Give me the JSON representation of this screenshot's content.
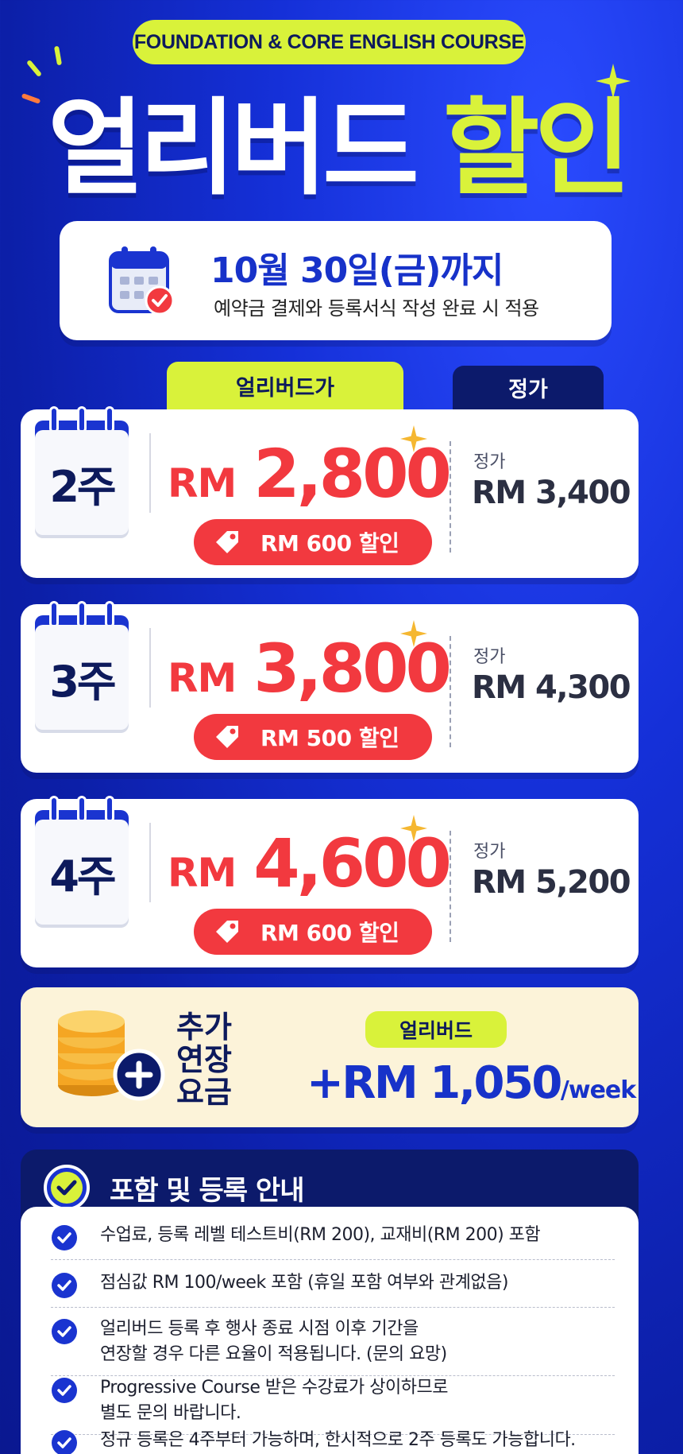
{
  "header": {
    "course_name": "FOUNDATION & CORE ENGLISH COURSE",
    "title_part1": "얼리버드",
    "title_part2": "할인"
  },
  "deadline": {
    "date": "10월 30일(금)까지",
    "condition": "예약금 결제와 등록서식 작성 완료 시 적용"
  },
  "columns": {
    "early": "얼리버드가",
    "regular": "정가"
  },
  "plans": [
    {
      "weeks": "2주",
      "currency": "RM",
      "early_price": "2,800",
      "discount": "RM 600 할인",
      "regular_label": "정가",
      "regular_price": "RM 3,400"
    },
    {
      "weeks": "3주",
      "currency": "RM",
      "early_price": "3,800",
      "discount": "RM 500 할인",
      "regular_label": "정가",
      "regular_price": "RM 4,300"
    },
    {
      "weeks": "4주",
      "currency": "RM",
      "early_price": "4,600",
      "discount": "RM 600 할인",
      "regular_label": "정가",
      "regular_price": "RM 5,200"
    }
  ],
  "extension": {
    "label_line1": "추가",
    "label_line2": "연장",
    "label_line3": "요금",
    "tag": "얼리버드",
    "price": "+RM 1,050",
    "unit": "/week"
  },
  "info": {
    "title": "포함 및 등록 안내",
    "items": [
      "수업료, 등록 레벨 테스트비(RM 200), 교재비(RM 200) 포함",
      "점심값 RM 100/week 포함 (휴일 포함 여부와 관계없음)",
      "얼리버드 등록 후 행사 종료 시점 이후 기간을\n연장할 경우 다른 요율이 적용됩니다. (문의 요망)",
      "Progressive Course 받은 수강료가 상이하므로\n별도 문의 바랍니다.",
      "정규 등록은 4주부터 가능하며, 한시적으로 2주 등록도 가능합니다."
    ]
  },
  "colors": {
    "background": "#1530d8",
    "accent_lime": "#d9f23a",
    "price_red": "#f2393f",
    "navy": "#0c1a6b"
  }
}
